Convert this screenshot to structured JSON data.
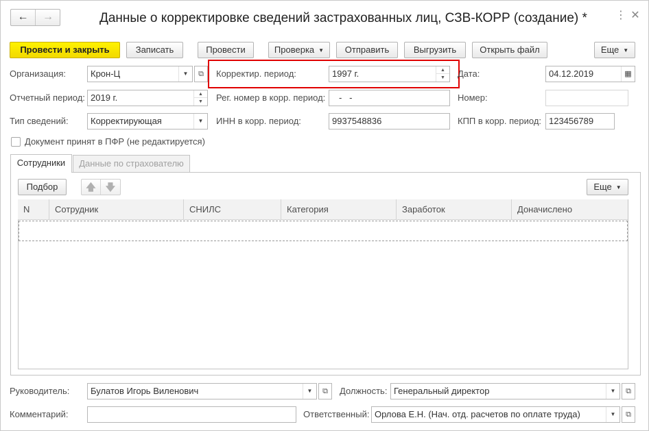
{
  "window": {
    "title": "Данные о корректировке сведений застрахованных лиц, СЗВ-КОРР (создание) *",
    "nav_back": "🡐",
    "nav_forward": "🡒"
  },
  "toolbar": {
    "post_close": "Провести и закрыть",
    "save": "Записать",
    "post": "Провести",
    "check": "Проверка",
    "send": "Отправить",
    "unload": "Выгрузить",
    "open_file": "Открыть файл",
    "more": "Еще"
  },
  "form": {
    "org_label": "Организация:",
    "org_value": "Крон-Ц",
    "period_label": "Отчетный период:",
    "period_value": "2019 г.",
    "type_label": "Тип сведений:",
    "type_value": "Корректирующая",
    "corr_period_label": "Корректир. период:",
    "corr_period_value": "1997 г.",
    "reg_label": "Рег. номер в корр. период:",
    "reg_value": "-   -",
    "inn_label": "ИНН в корр. период:",
    "inn_value": "9937548836",
    "date_label": "Дата:",
    "date_value": "04.12.2019",
    "number_label": "Номер:",
    "number_value": "",
    "kpp_label": "КПП в корр. период:",
    "kpp_value": "123456789",
    "accepted_label": "Документ принят в ПФР (не редактируется)"
  },
  "tabs": [
    {
      "label": "Сотрудники",
      "active": true
    },
    {
      "label": "Данные по страхователю",
      "active": false
    }
  ],
  "table_toolbar": {
    "select": "Подбор",
    "more": "Еще"
  },
  "table": {
    "columns": [
      "N",
      "Сотрудник",
      "СНИЛС",
      "Категория",
      "Заработок",
      "Доначислено"
    ],
    "rows": []
  },
  "footer": {
    "head_label": "Руководитель:",
    "head_value": "Булатов Игорь Виленович",
    "position_label": "Должность:",
    "position_value": "Генеральный директор",
    "comment_label": "Комментарий:",
    "comment_value": "",
    "resp_label": "Ответственный:",
    "resp_value": "Орлова Е.Н. (Нач. отд. расчетов по оплате труда)"
  },
  "colors": {
    "primary_button": "#f5e000",
    "highlight_frame": "#e00000"
  }
}
